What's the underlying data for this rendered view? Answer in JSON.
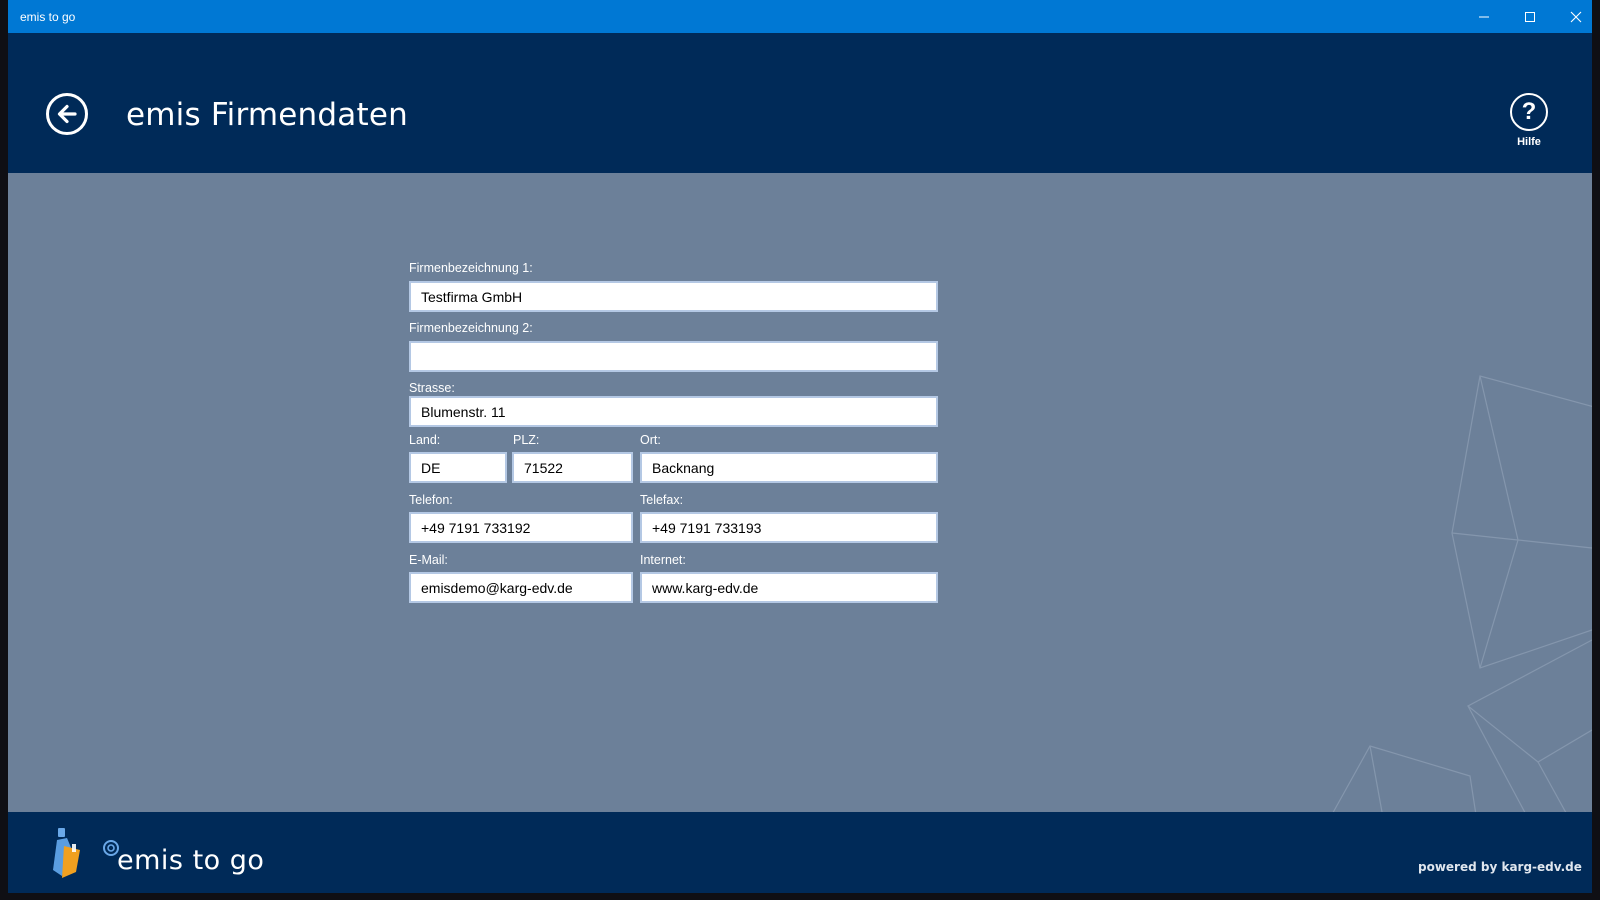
{
  "window": {
    "title": "emis to go"
  },
  "header": {
    "title": "emis Firmendaten",
    "help_label": "Hilfe"
  },
  "form": {
    "firmenbezeichnung1": {
      "label": "Firmenbezeichnung 1:",
      "value": "Testfirma GmbH"
    },
    "firmenbezeichnung2": {
      "label": "Firmenbezeichnung 2:",
      "value": ""
    },
    "strasse": {
      "label": "Strasse:",
      "value": "Blumenstr. 11"
    },
    "land": {
      "label": "Land:",
      "value": "DE"
    },
    "plz": {
      "label": "PLZ:",
      "value": "71522"
    },
    "ort": {
      "label": "Ort:",
      "value": "Backnang"
    },
    "telefon": {
      "label": "Telefon:",
      "value": "+49 7191 733192"
    },
    "telefax": {
      "label": "Telefax:",
      "value": "+49 7191 733193"
    },
    "email": {
      "label": "E-Mail:",
      "value": "emisdemo@karg-edv.de"
    },
    "internet": {
      "label": "Internet:",
      "value": "www.karg-edv.de"
    }
  },
  "footer": {
    "app_name": "emis to go",
    "powered_by": "powered by karg-edv.de"
  },
  "icons": {
    "back": "arrow-left-circle-icon",
    "help": "question-circle-icon",
    "minimize": "minimize-icon",
    "maximize": "maximize-icon",
    "close": "close-icon",
    "logo": "emis-logo-icon"
  },
  "colors": {
    "titlebar": "#0078d4",
    "header": "#002a58",
    "content": "#6c8099",
    "field_border": "#b4c8e4"
  }
}
